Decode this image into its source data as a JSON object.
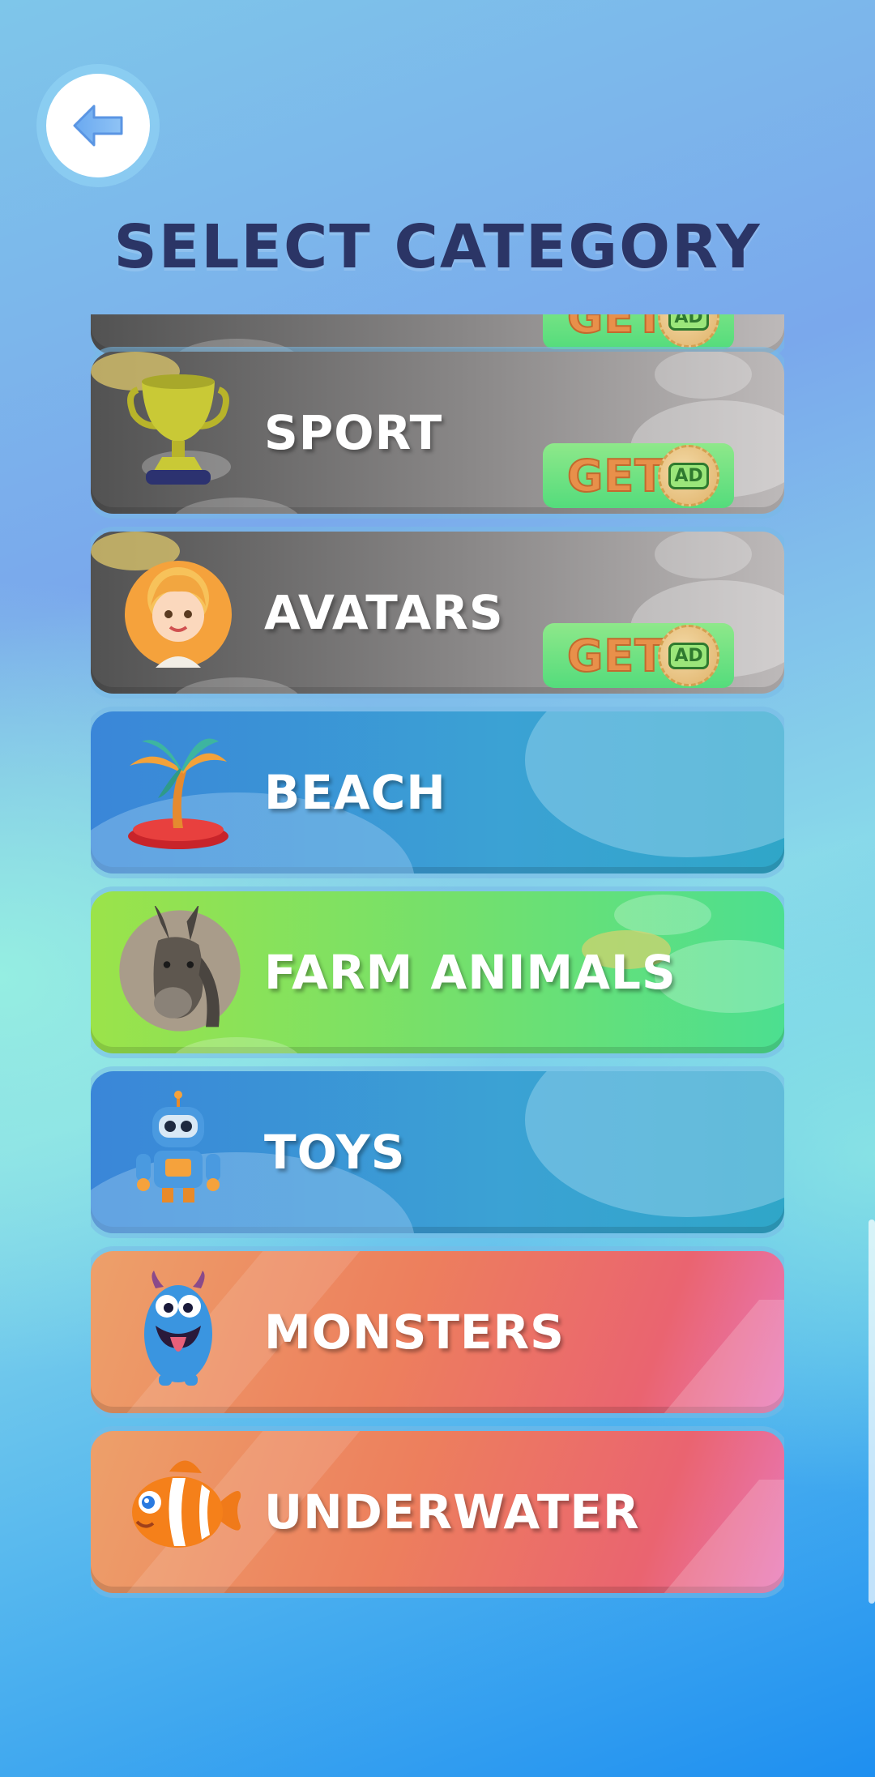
{
  "header": {
    "title": "SELECT CATEGORY",
    "back_icon": "arrow-left-icon"
  },
  "colors": {
    "title": "#2b3566",
    "locked": "#8a8888",
    "blue": "#3a86d8",
    "green": "#72e06e",
    "orange": "#ed7f5d"
  },
  "categories": [
    {
      "label": "",
      "style": "locked",
      "icon": "partial-card",
      "locked": true
    },
    {
      "label": "SPORT",
      "style": "locked",
      "icon": "trophy-icon",
      "locked": true
    },
    {
      "label": "AVATARS",
      "style": "locked",
      "icon": "avatar-girl-icon",
      "locked": true
    },
    {
      "label": "BEACH",
      "style": "blue",
      "icon": "palm-island-icon",
      "locked": false
    },
    {
      "label": "FARM ANIMALS",
      "style": "green",
      "icon": "donkey-icon",
      "locked": false
    },
    {
      "label": "TOYS",
      "style": "blue",
      "icon": "robot-icon",
      "locked": false
    },
    {
      "label": "MONSTERS",
      "style": "orange",
      "icon": "monster-icon",
      "locked": false
    },
    {
      "label": "UNDERWATER",
      "style": "orange",
      "icon": "clownfish-icon",
      "locked": false
    }
  ],
  "unlock": {
    "get_label": "GET",
    "ad_label": "AD"
  }
}
